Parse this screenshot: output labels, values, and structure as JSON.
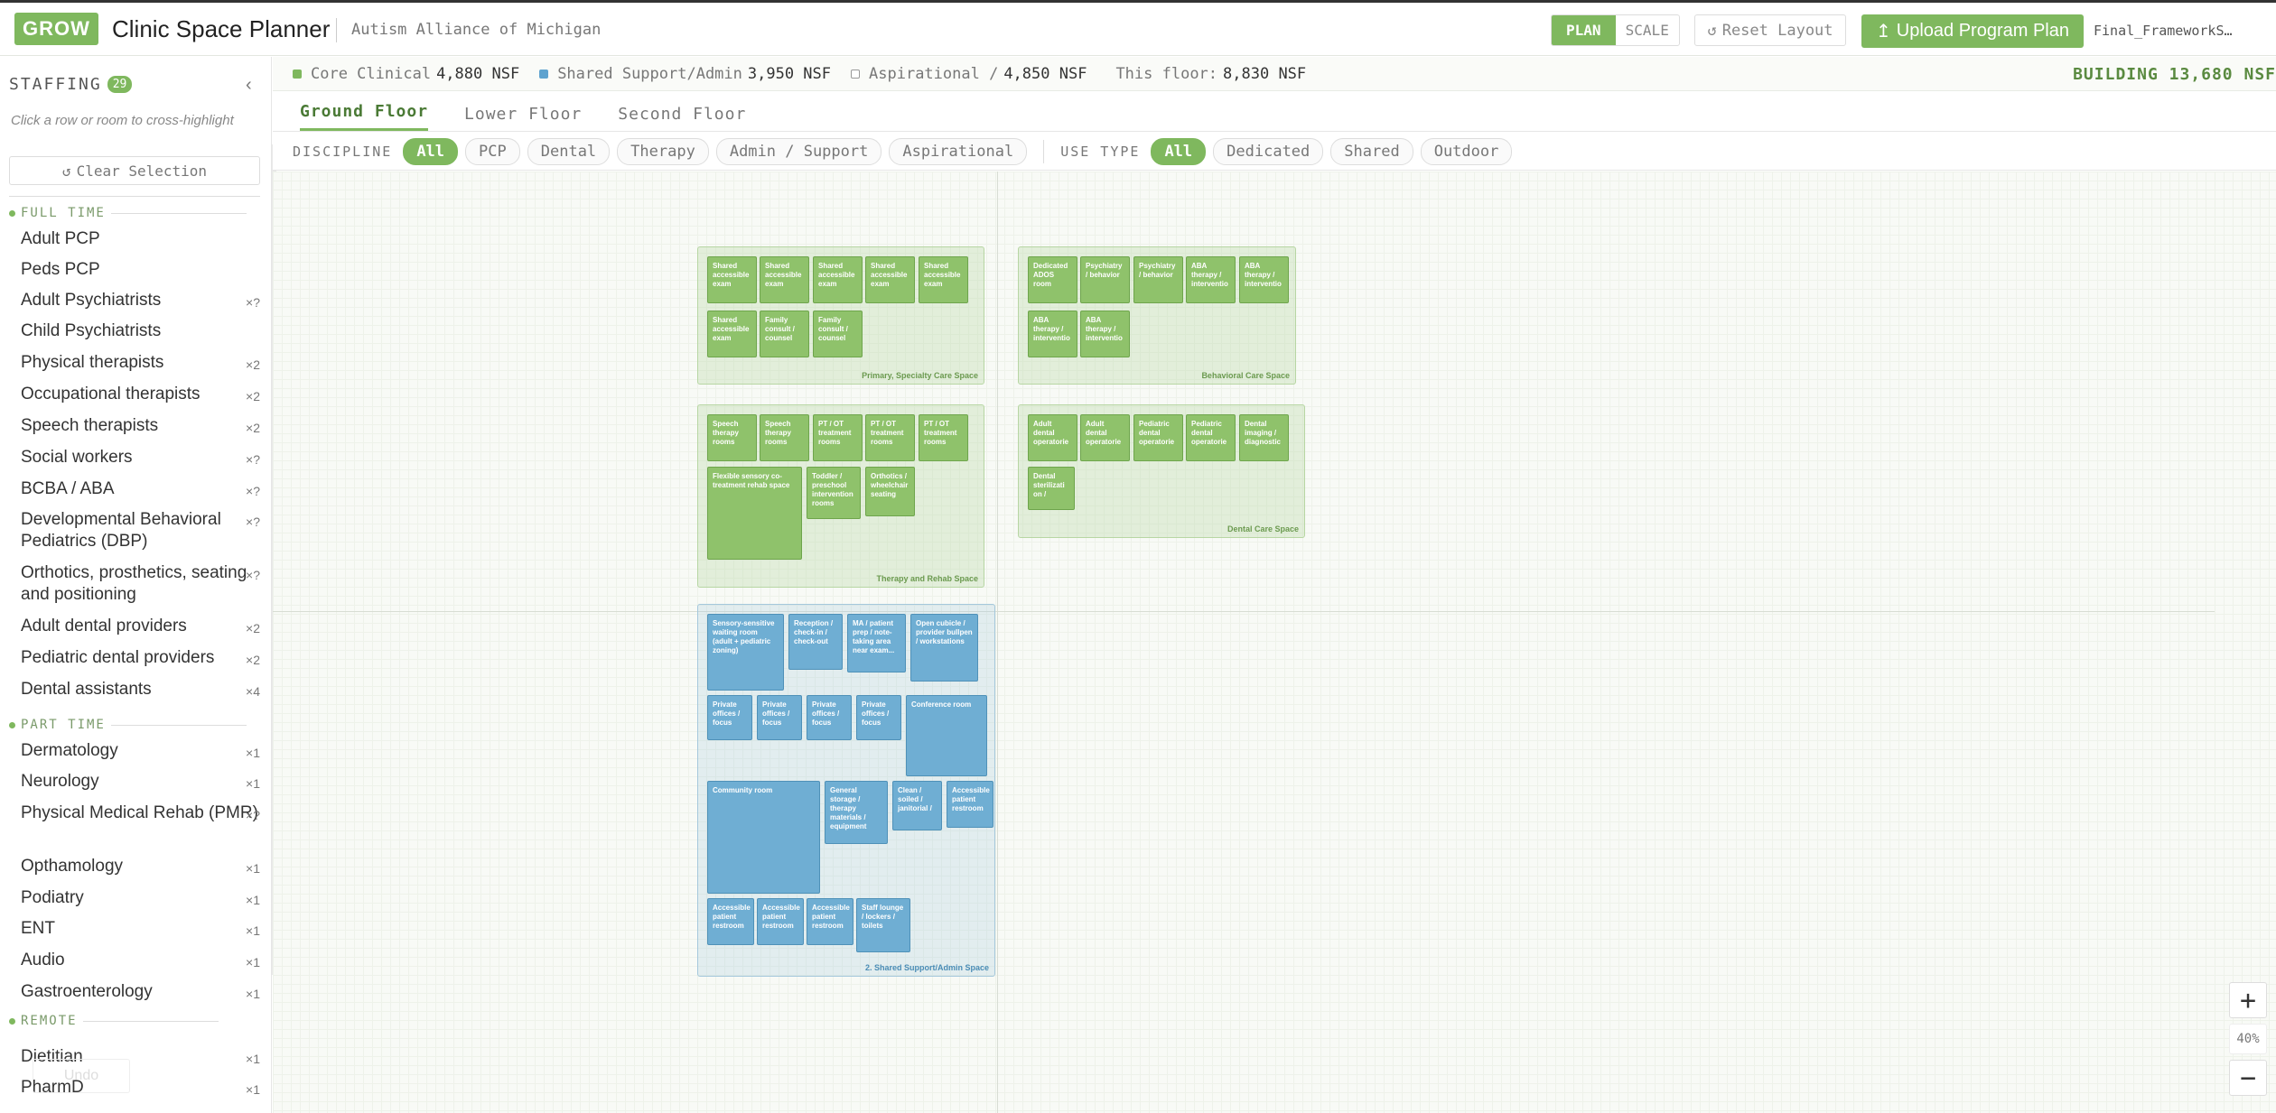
{
  "header": {
    "logo": "GROW",
    "title": "Clinic Space Planner",
    "org": "Autism Alliance of Michigan",
    "view_plan": "PLAN",
    "view_scale": "SCALE",
    "reset": "Reset Layout",
    "upload": "Upload Program Plan",
    "filename": "Final_FrameworkS…"
  },
  "sidebar": {
    "title": "STAFFING",
    "count": "29",
    "hint": "Click a row or room to cross-highlight",
    "clear": "Clear Selection",
    "undo": "Undo",
    "groups": [
      {
        "label": "FULL TIME",
        "items": [
          {
            "name": "Adult PCP",
            "count": ""
          },
          {
            "name": "Peds PCP",
            "count": ""
          },
          {
            "name": "Adult Psychiatrists",
            "count": "×?"
          },
          {
            "name": "Child Psychiatrists",
            "count": ""
          },
          {
            "name": "Physical therapists",
            "count": "×2"
          },
          {
            "name": "Occupational therapists",
            "count": "×2"
          },
          {
            "name": "Speech therapists",
            "count": "×2"
          },
          {
            "name": "Social workers",
            "count": "×?"
          },
          {
            "name": "BCBA / ABA",
            "count": "×?"
          },
          {
            "name": "Developmental Behavioral Pediatrics (DBP)",
            "count": "×?"
          },
          {
            "name": "Orthotics, prosthetics, seating and positioning",
            "count": "×?"
          },
          {
            "name": "Adult dental providers",
            "count": "×2"
          },
          {
            "name": "Pediatric dental providers",
            "count": "×2"
          },
          {
            "name": "Dental assistants",
            "count": "×4"
          }
        ]
      },
      {
        "label": "PART TIME",
        "items": [
          {
            "name": "Dermatology",
            "count": "×1"
          },
          {
            "name": "Neurology",
            "count": "×1"
          },
          {
            "name": "Physical Medical Rehab (PMR)",
            "count": "×?"
          },
          {
            "name": "Opthamology",
            "count": "×1"
          },
          {
            "name": "Podiatry",
            "count": "×1"
          },
          {
            "name": "ENT",
            "count": "×1"
          },
          {
            "name": "Audio",
            "count": "×1"
          },
          {
            "name": "Gastroenterology",
            "count": "×1"
          }
        ]
      },
      {
        "label": "REMOTE",
        "items": [
          {
            "name": "Dietitian",
            "count": "×1"
          },
          {
            "name": "PharmD",
            "count": "×1"
          }
        ]
      }
    ]
  },
  "summary": {
    "core_label": "Core Clinical",
    "core_value": "4,880 NSF",
    "shared_label": "Shared Support/Admin",
    "shared_value": "3,950 NSF",
    "asp_label": "Aspirational /",
    "asp_value": "4,850 NSF",
    "floor_label": "This floor:",
    "floor_value": "8,830 NSF",
    "building": "BUILDING 13,680 NSF",
    "colors": {
      "core": "#7fb85e",
      "shared": "#5fa3cf",
      "asp": "#ffffff"
    }
  },
  "floors": [
    "Ground Floor",
    "Lower Floor",
    "Second Floor"
  ],
  "filters": {
    "discipline_label": "DISCIPLINE",
    "discipline": [
      "All",
      "PCP",
      "Dental",
      "Therapy",
      "Admin / Support",
      "Aspirational"
    ],
    "use_label": "USE TYPE",
    "use": [
      "All",
      "Dedicated",
      "Shared",
      "Outdoor"
    ]
  },
  "zones": [
    {
      "label": "Primary, Specialty Care Space",
      "rooms": [
        "Shared accessible exam",
        "Shared accessible exam",
        "Shared accessible exam",
        "Shared accessible exam",
        "Shared accessible exam",
        "Shared accessible exam",
        "Family consult / counsel",
        "Family consult / counsel"
      ]
    },
    {
      "label": "Behavioral Care Space",
      "rooms": [
        "Dedicated ADOS room",
        "Psychiatry / behavior",
        "Psychiatry / behavior",
        "ABA therapy / interventio",
        "ABA therapy / interventio",
        "ABA therapy / interventio",
        "ABA therapy / interventio"
      ]
    },
    {
      "label": "Therapy and Rehab Space",
      "rooms": [
        "Speech therapy rooms",
        "Speech therapy rooms",
        "PT / OT treatment rooms",
        "PT / OT treatment rooms",
        "PT / OT treatment rooms",
        "Flexible sensory co-treatment rehab space",
        "Toddler / preschool intervention rooms",
        "Orthotics / wheelchair seating"
      ]
    },
    {
      "label": "Dental Care Space",
      "rooms": [
        "Adult dental operatorie",
        "Adult dental operatorie",
        "Pediatric dental operatorie",
        "Pediatric dental operatorie",
        "Dental imaging / diagnostic",
        "Dental sterilizati on /"
      ]
    },
    {
      "label": "2. Shared Support/Admin Space",
      "rooms": [
        "Sensory-sensitive waiting room (adult + pediatric zoning)",
        "Reception / check-in / check-out",
        "MA / patient prep / note-taking area near exam...",
        "Open cubicle / provider bullpen / workstations",
        "Private offices / focus",
        "Private offices / focus",
        "Private offices / focus",
        "Private offices / focus",
        "Conference room",
        "Community room",
        "General storage / therapy materials / equipment",
        "Clean / soiled / janitorial /",
        "Accessible patient restroom",
        "Accessible patient restroom",
        "Accessible patient restroom",
        "Accessible patient restroom",
        "Staff lounge / lockers / toilets"
      ]
    }
  ],
  "zoom": "40%"
}
